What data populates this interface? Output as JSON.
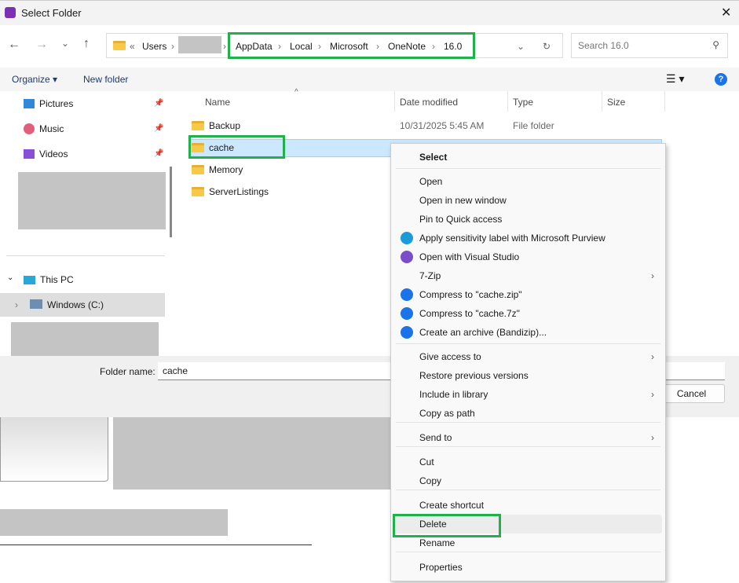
{
  "window": {
    "title": "Select Folder"
  },
  "address": {
    "overflow": "«",
    "crumbs": [
      "Users",
      "AppData",
      "Local",
      "Microsoft",
      "OneNote",
      "16.0"
    ]
  },
  "search": {
    "placeholder": "Search 16.0"
  },
  "toolbar": {
    "organize": "Organize",
    "new_folder": "New folder"
  },
  "sidebar": {
    "items": [
      {
        "label": "Pictures",
        "icon": "pictures-icon"
      },
      {
        "label": "Music",
        "icon": "music-icon"
      },
      {
        "label": "Videos",
        "icon": "videos-icon"
      }
    ],
    "this_pc": "This PC",
    "drive": "Windows (C:)"
  },
  "columns": [
    "Name",
    "Date modified",
    "Type",
    "Size"
  ],
  "files": [
    {
      "name": "Backup",
      "date": "10/31/2025 5:45 AM",
      "type": "File folder"
    },
    {
      "name": "cache"
    },
    {
      "name": "Memory"
    },
    {
      "name": "ServerListings"
    }
  ],
  "footer": {
    "folder_label": "Folder name:",
    "folder_value": "cache",
    "cancel": "Cancel"
  },
  "menu": {
    "items": [
      "Select",
      "Open",
      "Open in new window",
      "Pin to Quick access",
      "Apply sensitivity label with Microsoft Purview",
      "Open with Visual Studio",
      "7-Zip",
      "Compress to \"cache.zip\"",
      "Compress to \"cache.7z\"",
      "Create an archive (Bandizip)...",
      "Give access to",
      "Restore previous versions",
      "Include in library",
      "Copy as path",
      "Send to",
      "Cut",
      "Copy",
      "Create shortcut",
      "Delete",
      "Rename",
      "Properties"
    ]
  },
  "colors": {
    "highlight": "#21b04b",
    "selection": "#cce8ff"
  }
}
